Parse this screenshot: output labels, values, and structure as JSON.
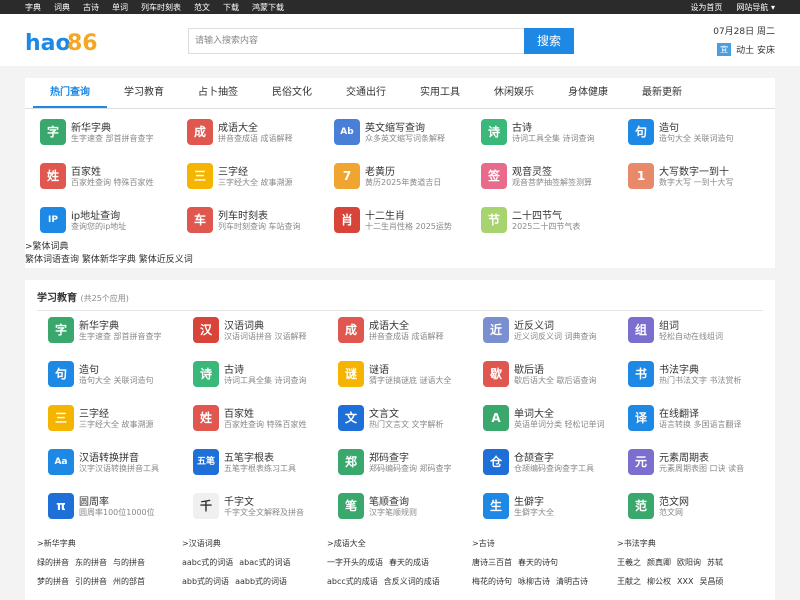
{
  "topbar": {
    "links": [
      "字典",
      "词典",
      "古诗",
      "单词",
      "列车时刻表",
      "范文",
      "下载",
      "鸿蒙下载"
    ],
    "set_home": "设为首页",
    "site_nav": "网站导航"
  },
  "header": {
    "logo": "hao86",
    "search_placeholder": "请输入搜索内容",
    "search_button": "搜索",
    "date": "07月28日 周二",
    "yi_badge": "宜",
    "yi_text": "动土 安床"
  },
  "tabs": [
    "热门查询",
    "学习教育",
    "占卜抽签",
    "民俗文化",
    "交通出行",
    "实用工具",
    "休闲娱乐",
    "身体健康",
    "最新更新"
  ],
  "hot": [
    {
      "title": "新华字典",
      "desc": "生字速查 部首拼音查字",
      "icon": "字",
      "color": "#3aa76d"
    },
    {
      "title": "成语大全",
      "desc": "拼音查成语 成语解释",
      "icon": "成",
      "color": "#e0574f"
    },
    {
      "title": "英文缩写查询",
      "desc": "众多英文缩写词条解释",
      "icon": "Ab",
      "color": "#4a7fd8"
    },
    {
      "title": "古诗",
      "desc": "诗词工具全集 诗词查询",
      "icon": "诗",
      "color": "#3ab87a"
    },
    {
      "title": "造句",
      "desc": "造句大全 关联词造句",
      "icon": "句",
      "color": "#1e88e5"
    },
    {
      "title": "百家姓",
      "desc": "百家姓查询 特殊百家姓",
      "icon": "姓",
      "color": "#e0574f"
    },
    {
      "title": "三字经",
      "desc": "三字经大全 故事溯源",
      "icon": "三",
      "color": "#f5b400"
    },
    {
      "title": "老黄历",
      "desc": "黄历2025年黄道吉日",
      "icon": "7",
      "color": "#f0a530"
    },
    {
      "title": "观音灵签",
      "desc": "观音菩萨抽签解签测算",
      "icon": "签",
      "color": "#e86b8c"
    },
    {
      "title": "大写数字一到十",
      "desc": "数字大写 一到十大写",
      "icon": "1",
      "color": "#e88a6a"
    },
    {
      "title": "ip地址查询",
      "desc": "查询您的ip地址",
      "icon": "IP",
      "color": "#1e88e5"
    },
    {
      "title": "列车时刻表",
      "desc": "列车时刻查询 车站查询",
      "icon": "车",
      "color": "#e0574f"
    },
    {
      "title": "十二生肖",
      "desc": "十二生肖性格 2025运势",
      "icon": "肖",
      "color": "#d9443a"
    },
    {
      "title": "二十四节气",
      "desc": "2025二十四节气表",
      "icon": "节",
      "color": "#a8d46f"
    }
  ],
  "fanti": {
    "title": ">繁体词典",
    "links": "繁体词语查询 繁体新华字典 繁体近反义词"
  },
  "study": {
    "title": "学习教育",
    "count": "(共25个应用)",
    "items": [
      {
        "title": "新华字典",
        "desc": "生字速查 部首拼音查字",
        "icon": "字",
        "color": "#3aa76d"
      },
      {
        "title": "汉语词典",
        "desc": "汉语词语拼音 汉语解释",
        "icon": "汉",
        "color": "#d9443a"
      },
      {
        "title": "成语大全",
        "desc": "拼音查成语 成语解释",
        "icon": "成",
        "color": "#e0574f"
      },
      {
        "title": "近反义词",
        "desc": "近义词反义词 词典查询",
        "icon": "近",
        "color": "#7a8fcf"
      },
      {
        "title": "组词",
        "desc": "轻松自动在线组词",
        "icon": "组",
        "color": "#7a6fcf"
      },
      {
        "title": "造句",
        "desc": "造句大全 关联词造句",
        "icon": "句",
        "color": "#1e88e5"
      },
      {
        "title": "古诗",
        "desc": "诗词工具全集 诗词查询",
        "icon": "诗",
        "color": "#3ab87a"
      },
      {
        "title": "谜语",
        "desc": "猜字谜搞谜底 谜语大全",
        "icon": "谜",
        "color": "#f5b400"
      },
      {
        "title": "歇后语",
        "desc": "歇后语大全 歇后语查询",
        "icon": "歇",
        "color": "#e0574f"
      },
      {
        "title": "书法字典",
        "desc": "热门书法文字 书法赏析",
        "icon": "书",
        "color": "#1e88e5"
      },
      {
        "title": "三字经",
        "desc": "三字经大全 故事溯源",
        "icon": "三",
        "color": "#f5b400"
      },
      {
        "title": "百家姓",
        "desc": "百家姓查询 特殊百家姓",
        "icon": "姓",
        "color": "#e0574f"
      },
      {
        "title": "文言文",
        "desc": "热门文言文 文字解析",
        "icon": "文",
        "color": "#1e6fd8"
      },
      {
        "title": "单词大全",
        "desc": "英语单词分类 轻松记单词",
        "icon": "A",
        "color": "#3aa76d"
      },
      {
        "title": "在线翻译",
        "desc": "语言转换 多国语言翻译",
        "icon": "译",
        "color": "#1e88e5"
      },
      {
        "title": "汉语转换拼音",
        "desc": "汉字汉语转换拼音工具",
        "icon": "Aa",
        "color": "#1e88e5"
      },
      {
        "title": "五笔字根表",
        "desc": "五笔字根表练习工具",
        "icon": "五笔",
        "color": "#1e6fd8"
      },
      {
        "title": "郑码查字",
        "desc": "郑码编码查询 郑码查字",
        "icon": "郑",
        "color": "#3aa76d"
      },
      {
        "title": "仓颉查字",
        "desc": "仓颉编码查询查字工具",
        "icon": "仓",
        "color": "#1e6fd8"
      },
      {
        "title": "元素周期表",
        "desc": "元素周期表图 口诀 读音",
        "icon": "元",
        "color": "#7a6fcf"
      },
      {
        "title": "圆周率",
        "desc": "圆周率100位1000位",
        "icon": "π",
        "color": "#1e6fd8"
      },
      {
        "title": "千字文",
        "desc": "千字文全文解释及拼音",
        "icon": "千",
        "color": "#f0f0f0"
      },
      {
        "title": "笔顺查询",
        "desc": "汉字笔顺规则",
        "icon": "笔",
        "color": "#3aa76d"
      },
      {
        "title": "生僻字",
        "desc": "生僻字大全",
        "icon": "生",
        "color": "#1e88e5"
      },
      {
        "title": "范文网",
        "desc": "范文网",
        "icon": "范",
        "color": "#3aa76d"
      }
    ]
  },
  "bottom": [
    {
      "h": ">新华字典",
      "rows": [
        [
          "绿的拼音",
          "东的拼音",
          "与的拼音"
        ],
        [
          "梦的拼音",
          "引的拼音",
          "州的部首"
        ]
      ]
    },
    {
      "h": ">汉语词典",
      "rows": [
        [
          "aabc式的词语",
          "abac式的词语"
        ],
        [
          "abb式的词语",
          "aabb式的词语"
        ]
      ]
    },
    {
      "h": ">成语大全",
      "rows": [
        [
          "一字开头的成语",
          "春天的成语"
        ],
        [
          "abcc式的成语",
          "含反义词的成语"
        ]
      ]
    },
    {
      "h": ">古诗",
      "rows": [
        [
          "唐诗三百首",
          "春天的诗句"
        ],
        [
          "梅花的诗句",
          "咏柳古诗",
          "清明古诗"
        ]
      ]
    },
    {
      "h": ">书法字典",
      "rows": [
        [
          "王羲之",
          "颜真卿",
          "欧阳询",
          "苏轼"
        ],
        [
          "王献之",
          "柳公权",
          "XXX",
          "吴昌硕"
        ]
      ]
    }
  ]
}
